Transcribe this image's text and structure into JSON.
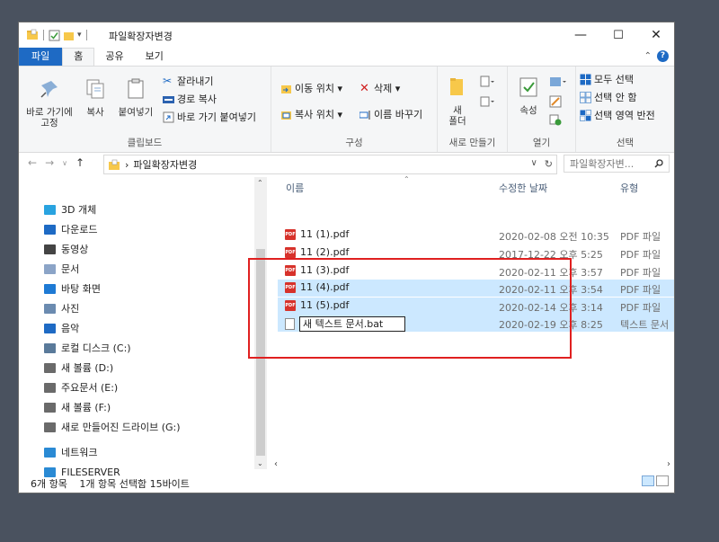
{
  "window": {
    "title": "파일확장자변경",
    "controls": {
      "minimize": "—",
      "maximize": "☐",
      "close": "✕"
    }
  },
  "ribbon_tabs": [
    "파일",
    "홈",
    "공유",
    "보기"
  ],
  "ribbon": {
    "clipboard": {
      "pin_label": "바로 가기에\n고정",
      "copy_label": "복사",
      "paste_label": "붙여넣기",
      "cut": "잘라내기",
      "copy_path": "경로 복사",
      "paste_shortcut": "바로 가기 붙여넣기",
      "group": "클립보드"
    },
    "organize": {
      "move_to": "이동 위치 ▾",
      "delete": "삭제 ▾",
      "copy_to": "복사 위치 ▾",
      "rename": "이름 바꾸기",
      "group": "구성"
    },
    "new": {
      "new_folder": "새\n폴더",
      "group": "새로 만들기"
    },
    "open": {
      "properties": "속성",
      "group": "열기"
    },
    "select": {
      "select_all": "모두 선택",
      "select_none": "선택 안 함",
      "invert": "선택 영역 반전",
      "group": "선택"
    }
  },
  "address": {
    "path": "파일확장자변경",
    "search_placeholder": "파일확장자변...",
    "search_icon": "search-icon"
  },
  "nav_items": [
    {
      "label": "3D 개체",
      "icon": "cube-icon",
      "color": "#29a3e0"
    },
    {
      "label": "다운로드",
      "icon": "download-icon",
      "color": "#1e6ac4"
    },
    {
      "label": "동영상",
      "icon": "film-icon",
      "color": "#444"
    },
    {
      "label": "문서",
      "icon": "document-icon",
      "color": "#8ba4c7"
    },
    {
      "label": "바탕 화면",
      "icon": "desktop-icon",
      "color": "#1e7ad4"
    },
    {
      "label": "사진",
      "icon": "picture-icon",
      "color": "#6b8bb0"
    },
    {
      "label": "음악",
      "icon": "music-icon",
      "color": "#1e6ac4"
    },
    {
      "label": "로컬 디스크 (C:)",
      "icon": "system-drive-icon",
      "color": "#5a7a9a"
    },
    {
      "label": "새 볼륨 (D:)",
      "icon": "drive-icon",
      "color": "#6a6a6a"
    },
    {
      "label": "주요문서 (E:)",
      "icon": "drive-icon",
      "color": "#6a6a6a"
    },
    {
      "label": "새 볼륨 (F:)",
      "icon": "drive-icon",
      "color": "#6a6a6a"
    },
    {
      "label": "새로 만들어진 드라이브 (G:)",
      "icon": "drive-icon",
      "color": "#6a6a6a"
    },
    {
      "label": "네트워크",
      "icon": "network-icon",
      "color": "#2a8ad4"
    },
    {
      "label": "FILESERVER",
      "icon": "computer-icon",
      "color": "#2a8ad4"
    }
  ],
  "columns": {
    "name": "이름",
    "date": "수정한 날짜",
    "type": "유형"
  },
  "files": [
    {
      "name": "11 (1).pdf",
      "date": "2020-02-08 오전 10:35",
      "type": "PDF 파일"
    },
    {
      "name": "11 (2).pdf",
      "date": "2017-12-22 오후 5:25",
      "type": "PDF 파일"
    },
    {
      "name": "11 (3).pdf",
      "date": "2020-02-11 오후 3:57",
      "type": "PDF 파일"
    },
    {
      "name": "11 (4).pdf",
      "date": "2020-02-11 오후 3:54",
      "type": "PDF 파일"
    },
    {
      "name": "11 (5).pdf",
      "date": "2020-02-14 오후 3:14",
      "type": "PDF 파일"
    },
    {
      "name": "새 텍스트 문서.bat",
      "date": "2020-02-19 오후 8:25",
      "type": "텍스트 문서"
    }
  ],
  "status": {
    "count": "6개 항목",
    "selection": "1개 항목 선택함 15바이트"
  },
  "colors": {
    "accent": "#1e6ac4",
    "selection": "#cce8ff",
    "highlight_box": "#e02020"
  }
}
